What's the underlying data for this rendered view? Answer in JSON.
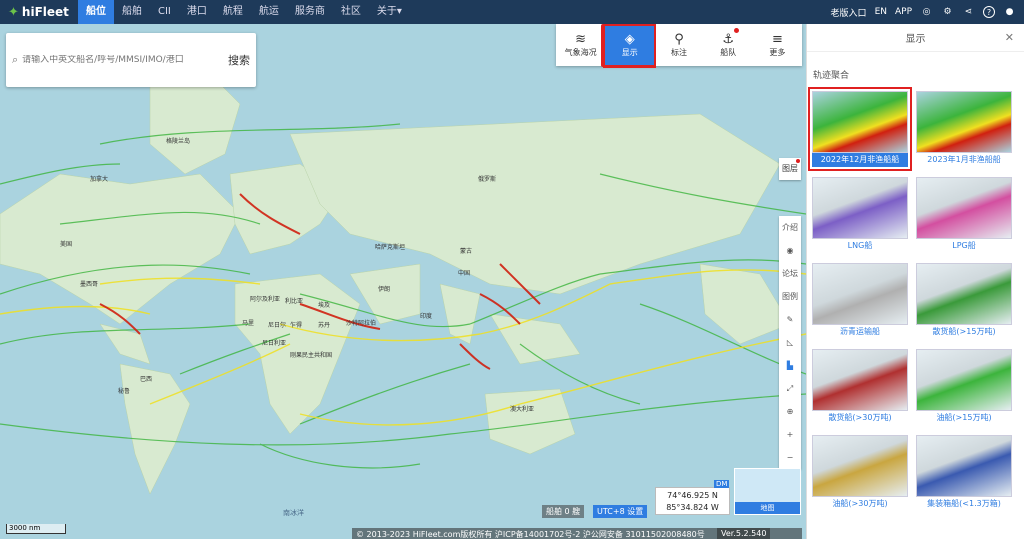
{
  "topbar": {
    "logo_text": "hiFleet",
    "nav": [
      "船位",
      "船舶",
      "CII",
      "港口",
      "航程",
      "航运",
      "服务商",
      "社区",
      "关于"
    ],
    "right": {
      "enterprise": "老版入口",
      "lang": "EN",
      "app": "APP"
    }
  },
  "search": {
    "placeholder": "请输入中英文船名/呼号/MMSI/IMO/港口",
    "button": "搜索"
  },
  "toolbar": [
    {
      "label": "气象海况",
      "icon": "weather-icon"
    },
    {
      "label": "显示",
      "icon": "layers-icon"
    },
    {
      "label": "标注",
      "icon": "pin-icon"
    },
    {
      "label": "船队",
      "icon": "fleet-icon"
    },
    {
      "label": "更多",
      "icon": "menu-icon"
    }
  ],
  "side_tools": {
    "legend_top": "图层",
    "items": [
      "介绍",
      "论坛",
      "图例"
    ]
  },
  "map": {
    "scale": "3000 nm",
    "ship_count": "船舶 0 艘",
    "utc": "UTC+8 设置",
    "coord_lat": "74°46.925 N",
    "coord_lon": "85°34.824 W",
    "dm": "DM",
    "minimap_label": "地图",
    "copyright": "© 2013-2023 HiFleet.com版权所有 沪ICP备14001702号-2 沪公网安备 31011502008480号",
    "version": "Ver.5.2.540",
    "ocean_label": "南冰洋",
    "labels": [
      "格陵兰岛",
      "俄罗斯",
      "哈萨克斯坦",
      "蒙古",
      "中国",
      "印度",
      "伊朗",
      "沙特阿拉伯",
      "阿尔及利亚",
      "利比亚",
      "埃及",
      "马里",
      "尼日尔",
      "乍得",
      "苏丹",
      "尼日利亚",
      "刚果民主共和国",
      "澳大利亚",
      "巴西",
      "秘鲁",
      "美国",
      "墨西哥",
      "加拿大"
    ]
  },
  "panel": {
    "title": "显示",
    "section": "轨迹聚合",
    "cards": [
      {
        "label": "2022年12月非渔船船",
        "selected": true
      },
      {
        "label": "2023年1月非渔船船",
        "selected": false
      },
      {
        "label": "LNG船",
        "selected": false
      },
      {
        "label": "LPG船",
        "selected": false
      },
      {
        "label": "沥青运输船",
        "selected": false
      },
      {
        "label": "散货船(>15万吨)",
        "selected": false
      },
      {
        "label": "散货船(>30万吨)",
        "selected": false
      },
      {
        "label": "油船(>15万吨)",
        "selected": false
      },
      {
        "label": "油船(>30万吨)",
        "selected": false
      },
      {
        "label": "集装箱船(<1.3万箱)",
        "selected": false
      }
    ]
  },
  "colors": {
    "accent": "#2f7de1",
    "highlight": "#e02020",
    "topbar": "#1e3a5a",
    "route_green": "#3cb43c",
    "route_yellow": "#f0e020",
    "route_red": "#d02010"
  }
}
